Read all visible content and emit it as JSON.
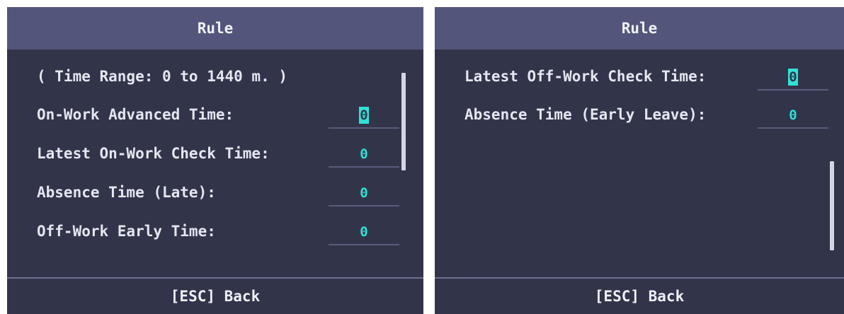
{
  "left_screen": {
    "title": "Rule",
    "range_hint": "( Time Range: 0 to 1440 m. )",
    "rows": [
      {
        "label": "On-Work Advanced Time:",
        "value": "0",
        "focused": true
      },
      {
        "label": "Latest On-Work Check Time:",
        "value": "0",
        "focused": false
      },
      {
        "label": "Absence Time (Late):",
        "value": "0",
        "focused": false
      },
      {
        "label": "Off-Work Early Time:",
        "value": "0",
        "focused": false
      }
    ],
    "back_label": "[ESC] Back"
  },
  "right_screen": {
    "title": "Rule",
    "rows": [
      {
        "label": "Latest Off-Work Check Time:",
        "value": "0",
        "focused": true
      },
      {
        "label": "Absence Time (Early Leave):",
        "value": "0",
        "focused": false
      }
    ],
    "back_label": "[ESC] Back"
  },
  "colors": {
    "background": "#32344a",
    "header": "#53567a",
    "value_accent": "#2ee3d6"
  }
}
